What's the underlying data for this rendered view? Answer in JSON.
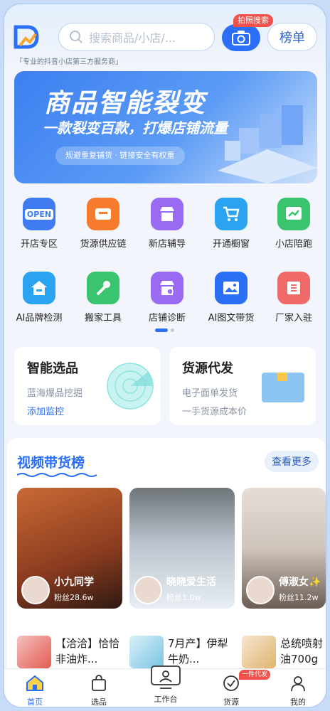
{
  "header": {
    "slogan": "「专业的抖音小店第三方服务商」",
    "search_placeholder": "搜索商品/小店/...",
    "camera_tag": "拍照搜索",
    "rank_label": "榜单"
  },
  "banner": {
    "title": "商品智能裂变",
    "subtitle": "一款裂变百款，打爆店铺流量",
    "pill": "规避重复铺货 · 链接安全有权重"
  },
  "grid": [
    {
      "label": "开店专区",
      "icon_text": "OPEN",
      "icon": "open-sign-icon",
      "color": "#3f7cf2"
    },
    {
      "label": "货源供应链",
      "icon_text": "",
      "icon": "supply-box-icon",
      "color": "#f77b2c"
    },
    {
      "label": "新店辅导",
      "icon_text": "",
      "icon": "shop-guide-icon",
      "color": "#9a6bf2"
    },
    {
      "label": "开通橱窗",
      "icon_text": "",
      "icon": "shopping-cart-icon",
      "color": "#2aa3f0"
    },
    {
      "label": "小店陪跑",
      "icon_text": "",
      "icon": "trend-chart-icon",
      "color": "#39c46d"
    },
    {
      "label": "AI品牌检测",
      "icon_text": "",
      "icon": "home-brand-icon",
      "color": "#2aa3f0"
    },
    {
      "label": "搬家工具",
      "icon_text": "",
      "icon": "wrench-tool-icon",
      "color": "#39c46d"
    },
    {
      "label": "店铺诊断",
      "icon_text": "",
      "icon": "shop-diagnose-icon",
      "color": "#9a6bf2"
    },
    {
      "label": "AI图文带货",
      "icon_text": "",
      "icon": "image-goods-icon",
      "color": "#2a6ff5"
    },
    {
      "label": "厂家入驻",
      "icon_text": "",
      "icon": "factory-entry-icon",
      "color": "#f06a6a"
    }
  ],
  "cards": {
    "left": {
      "title": "智能选品",
      "sub": "蓝海爆品挖掘",
      "link": "添加监控"
    },
    "right": {
      "title": "货源代发",
      "sub1": "电子面单发货",
      "sub2": "一手货源成本价"
    }
  },
  "video": {
    "title": "视频带货榜",
    "more": "查看更多",
    "items": [
      {
        "name": "小九同学",
        "fans": "粉丝28.6w"
      },
      {
        "name": "晓晓爱生活",
        "fans": "粉丝1.0w"
      },
      {
        "name": "傅淑女✨",
        "fans": "粉丝11.2w"
      }
    ],
    "products": [
      {
        "title": "【洽洽】恰恰非油炸..."
      },
      {
        "title": "7月产】伊犁牛奶..."
      },
      {
        "title": "总统喷射油700g"
      }
    ]
  },
  "tabbar": {
    "items": [
      {
        "label": "首页",
        "icon": "home-icon"
      },
      {
        "label": "选品",
        "icon": "bag-icon"
      },
      {
        "label": "工作台",
        "icon": "monitor-icon"
      },
      {
        "label": "货源",
        "icon": "supply-icon"
      },
      {
        "label": "我的",
        "icon": "user-icon"
      }
    ],
    "badge": "一件代发"
  },
  "colors": {
    "accent": "#2a6ff5",
    "badge": "#f0524b"
  }
}
